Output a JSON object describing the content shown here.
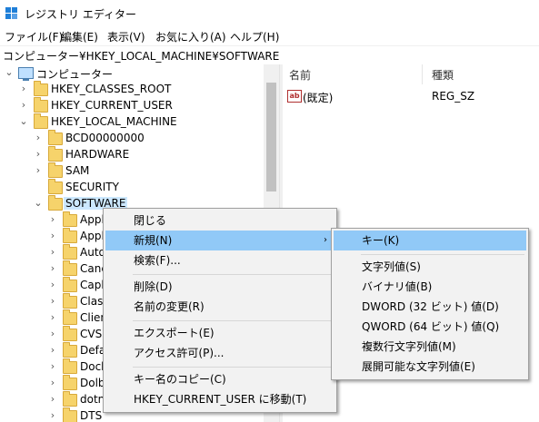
{
  "window": {
    "title": "レジストリ エディター"
  },
  "menubar": [
    "ファイル(F)",
    "編集(E)",
    "表示(V)",
    "お気に入り(A)",
    "ヘルプ(H)"
  ],
  "address": "コンピューター¥HKEY_LOCAL_MACHINE¥SOFTWARE",
  "tree": {
    "root": "コンピューター",
    "hives": [
      "HKEY_CLASSES_ROOT",
      "HKEY_CURRENT_USER",
      "HKEY_LOCAL_MACHINE"
    ],
    "hklm_children": [
      "BCD00000000",
      "HARDWARE",
      "SAM",
      "SECURITY",
      "SOFTWARE"
    ],
    "software_children": [
      "Appl",
      "Appl",
      "Auto",
      "Canc",
      "Caph",
      "Class",
      "Clien",
      "CVSM",
      "Defa",
      "Dock",
      "Dolb",
      "dotn",
      "DTS"
    ]
  },
  "values_pane": {
    "headers": {
      "name": "名前",
      "type": "種類"
    },
    "rows": [
      {
        "name": "(既定)",
        "type": "REG_SZ",
        "icon": "string-value-icon"
      }
    ]
  },
  "context_menu": {
    "items": [
      "閉じる",
      "新規(N)",
      "検索(F)...",
      "削除(D)",
      "名前の変更(R)",
      "エクスポート(E)",
      "アクセス許可(P)...",
      "キー名のコピー(C)",
      "HKEY_CURRENT_USER に移動(T)"
    ],
    "highlighted": "新規(N)",
    "submenu_arrow": "›"
  },
  "submenu": {
    "items": [
      "キー(K)",
      "文字列値(S)",
      "バイナリ値(B)",
      "DWORD (32 ビット) 値(D)",
      "QWORD (64 ビット) 値(Q)",
      "複数行文字列値(M)",
      "展開可能な文字列値(E)"
    ],
    "highlighted": "キー(K)"
  },
  "colors": {
    "highlight": "#91c9f7",
    "selection": "#cce8ff",
    "folder": "#f6d36b",
    "menu_bg": "#f2f2f2"
  }
}
